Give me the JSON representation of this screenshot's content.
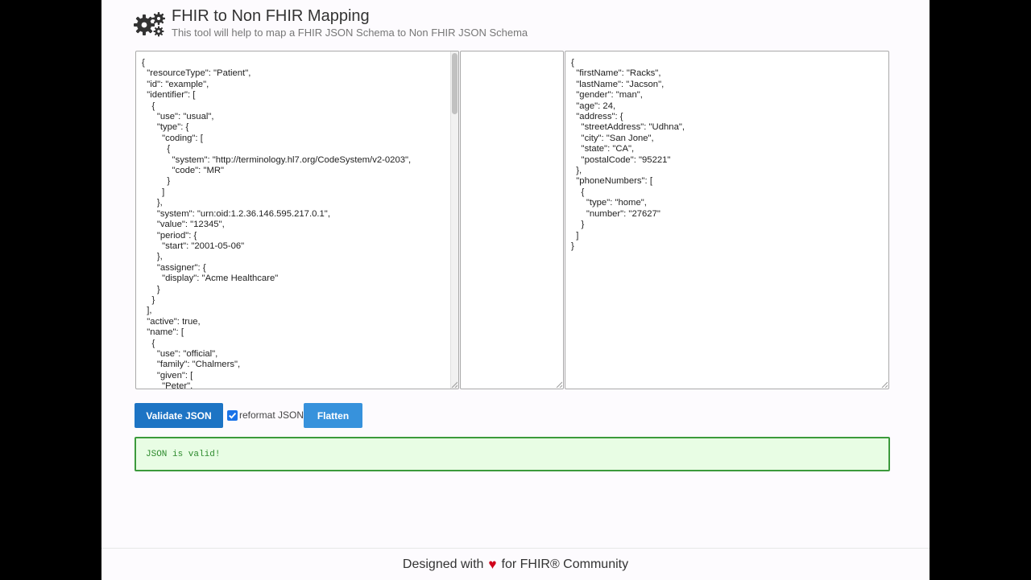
{
  "header": {
    "title": "FHIR to Non FHIR Mapping",
    "subtitle": "This tool will help to map a FHIR JSON Schema to Non FHIR JSON Schema",
    "icon": "gears-icon"
  },
  "editors": {
    "fhir_json": "{\n  \"resourceType\": \"Patient\",\n  \"id\": \"example\",\n  \"identifier\": [\n    {\n      \"use\": \"usual\",\n      \"type\": {\n        \"coding\": [\n          {\n            \"system\": \"http://terminology.hl7.org/CodeSystem/v2-0203\",\n            \"code\": \"MR\"\n          }\n        ]\n      },\n      \"system\": \"urn:oid:1.2.36.146.595.217.0.1\",\n      \"value\": \"12345\",\n      \"period\": {\n        \"start\": \"2001-05-06\"\n      },\n      \"assigner\": {\n        \"display\": \"Acme Healthcare\"\n      }\n    }\n  ],\n  \"active\": true,\n  \"name\": [\n    {\n      \"use\": \"official\",\n      \"family\": \"Chalmers\",\n      \"given\": [\n        \"Peter\",",
    "mapping": "",
    "non_fhir_json": "{\n  \"firstName\": \"Racks\",\n  \"lastName\": \"Jacson\",\n  \"gender\": \"man\",\n  \"age\": 24,\n  \"address\": {\n    \"streetAddress\": \"Udhna\",\n    \"city\": \"San Jone\",\n    \"state\": \"CA\",\n    \"postalCode\": \"95221\"\n  },\n  \"phoneNumbers\": [\n    {\n      \"type\": \"home\",\n      \"number\": \"27627\"\n    }\n  ]\n}"
  },
  "toolbar": {
    "validate_label": "Validate JSON",
    "reformat_label": "reformat JSON",
    "reformat_checked": true,
    "flatten_label": "Flatten"
  },
  "status": {
    "message": "JSON is valid!",
    "color": "#2e8b2e",
    "background": "#e8fde4"
  },
  "footer": {
    "prefix": "Designed with",
    "heart_icon": "heart-icon",
    "suffix": "for FHIR® Community"
  },
  "colors": {
    "primary_button": "#1d74c4",
    "secondary_button": "#3792dc",
    "heart": "#d0021b"
  }
}
